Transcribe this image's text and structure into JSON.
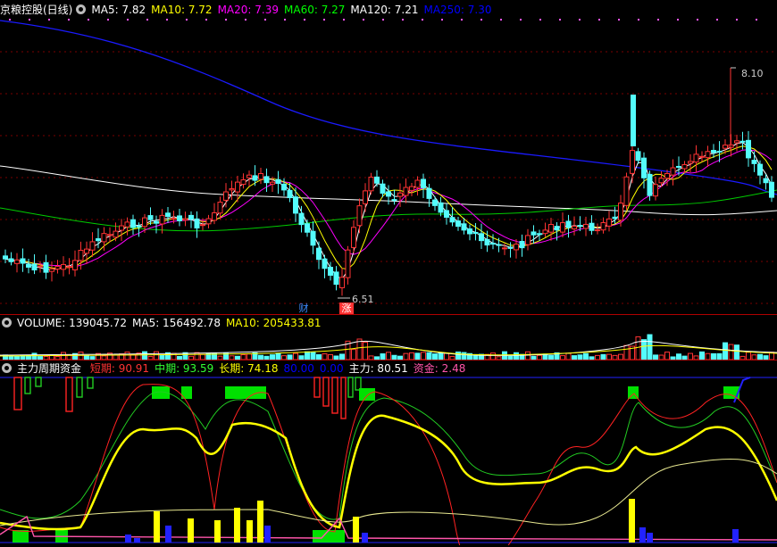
{
  "main": {
    "title": "京粮控股(日线)",
    "ma": [
      {
        "label": "MA5: 7.82",
        "color": "#ffffff"
      },
      {
        "label": "MA10: 7.72",
        "color": "#ffff00"
      },
      {
        "label": "MA20: 7.39",
        "color": "#ff00ff"
      },
      {
        "label": "MA60: 7.27",
        "color": "#00ff00"
      },
      {
        "label": "MA120: 7.21",
        "color": "#ffffff"
      },
      {
        "label": "MA250: 7.30",
        "color": "#0000ff"
      }
    ],
    "high_label": "8.10",
    "low_label": "6.51",
    "badge_cai": "财",
    "badge_zhang": "涨"
  },
  "volume": {
    "labels": [
      {
        "label": "VOLUME: 139045.72",
        "color": "#ffffff"
      },
      {
        "label": "MA5: 156492.78",
        "color": "#ffffff"
      },
      {
        "label": "MA10: 205433.81",
        "color": "#ffff00"
      }
    ]
  },
  "indicator": {
    "title": "主力周期资金",
    "items": [
      {
        "label": "短期: 90.91",
        "color": "#ff3333"
      },
      {
        "label": "中期: 93.59",
        "color": "#33ff33"
      },
      {
        "label": "长期: 74.18",
        "color": "#ffff00"
      },
      {
        "label": "80.00",
        "color": "#0000ff"
      },
      {
        "label": "0.00",
        "color": "#0000ff"
      },
      {
        "label": "主力: 80.51",
        "color": "#ffffff"
      },
      {
        "label": "资金: 2.48",
        "color": "#ff55aa"
      }
    ]
  },
  "colors": {
    "up": "#ff3333",
    "down": "#54fcfc",
    "ma250": "#0000ff",
    "grid": "#800000"
  }
}
